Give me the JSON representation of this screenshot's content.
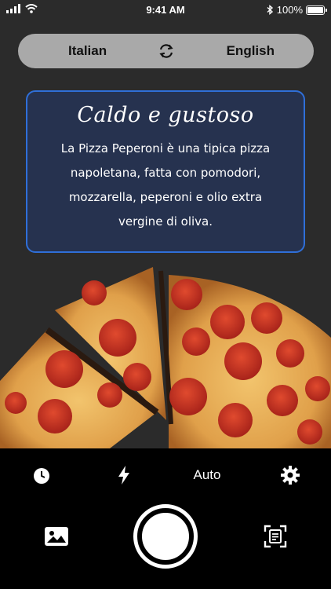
{
  "status_bar": {
    "time": "9:41 AM",
    "battery": "100%"
  },
  "language_bar": {
    "source": "Italian",
    "target": "English"
  },
  "translation": {
    "title": "Caldo e gustoso",
    "lines": [
      "La Pizza Peperoni è una tipica pizza",
      "napoletana, fatta con pomodori,",
      "mozzarella, peperoni e olio extra",
      "vergine di oliva."
    ]
  },
  "camera": {
    "flash_mode": "Auto"
  },
  "colors": {
    "accent": "#2f6fd8",
    "card_bg": "#26324f",
    "pill_bg": "#a9a9a9"
  }
}
